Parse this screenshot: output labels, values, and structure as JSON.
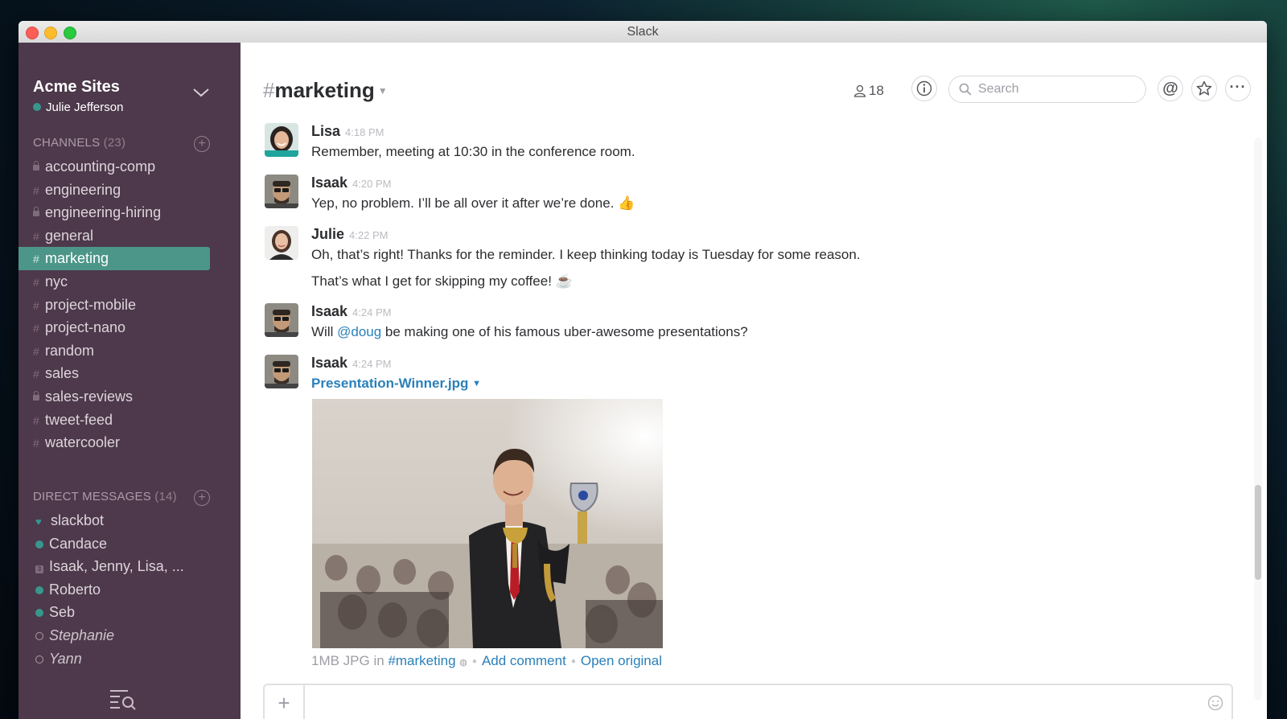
{
  "window": {
    "title": "Slack"
  },
  "sidebar": {
    "team_name": "Acme Sites",
    "user_name": "Julie Jefferson",
    "channels_header": "CHANNELS",
    "channels_count": "(23)",
    "channels": [
      {
        "name": "accounting-comp",
        "private": true
      },
      {
        "name": "engineering",
        "private": false
      },
      {
        "name": "engineering-hiring",
        "private": true
      },
      {
        "name": "general",
        "private": false
      },
      {
        "name": "marketing",
        "private": false,
        "active": true
      },
      {
        "name": "nyc",
        "private": false
      },
      {
        "name": "project-mobile",
        "private": false
      },
      {
        "name": "project-nano",
        "private": false
      },
      {
        "name": "random",
        "private": false
      },
      {
        "name": "sales",
        "private": false
      },
      {
        "name": "sales-reviews",
        "private": true
      },
      {
        "name": "tweet-feed",
        "private": false
      },
      {
        "name": "watercooler",
        "private": false
      }
    ],
    "dm_header": "DIRECT MESSAGES",
    "dm_count": "(14)",
    "direct_messages": [
      {
        "name": "slackbot",
        "status": "heart"
      },
      {
        "name": "Candace",
        "status": "online"
      },
      {
        "name": "Isaak, Jenny, Lisa, ...",
        "status": "group",
        "group_count": "3"
      },
      {
        "name": "Roberto",
        "status": "online"
      },
      {
        "name": "Seb",
        "status": "online"
      },
      {
        "name": "Stephanie",
        "status": "away"
      },
      {
        "name": "Yann",
        "status": "away"
      }
    ]
  },
  "header": {
    "hash": "#",
    "channel_name": "marketing",
    "member_count": "18",
    "search_placeholder": "Search"
  },
  "messages": [
    {
      "author": "Lisa",
      "time": "4:18 PM",
      "text": "Remember, meeting at 10:30 in the conference room."
    },
    {
      "author": "Isaak",
      "time": "4:20 PM",
      "text": "Yep, no problem. I’ll be all over it after we’re done. 👍"
    },
    {
      "author": "Julie",
      "time": "4:22 PM",
      "text": "Oh, that’s right! Thanks for the reminder. I keep thinking today is Tuesday for some reason.",
      "text2": "That’s what I get for skipping my coffee! ☕"
    },
    {
      "author": "Isaak",
      "time": "4:24 PM",
      "text_pre": "Will ",
      "mention": "@doug",
      "text_post": " be making one of his famous uber-awesome presentations?"
    },
    {
      "author": "Isaak",
      "time": "4:24 PM",
      "file_name": "Presentation-Winner.jpg",
      "file_size": "1MB JPG in",
      "file_channel": "#marketing",
      "add_comment": "Add comment",
      "open_original": "Open original"
    }
  ],
  "colors": {
    "sidebar_bg": "#4d394b",
    "active_channel": "#4c9689",
    "link": "#2a80b9",
    "online": "#38978d"
  }
}
